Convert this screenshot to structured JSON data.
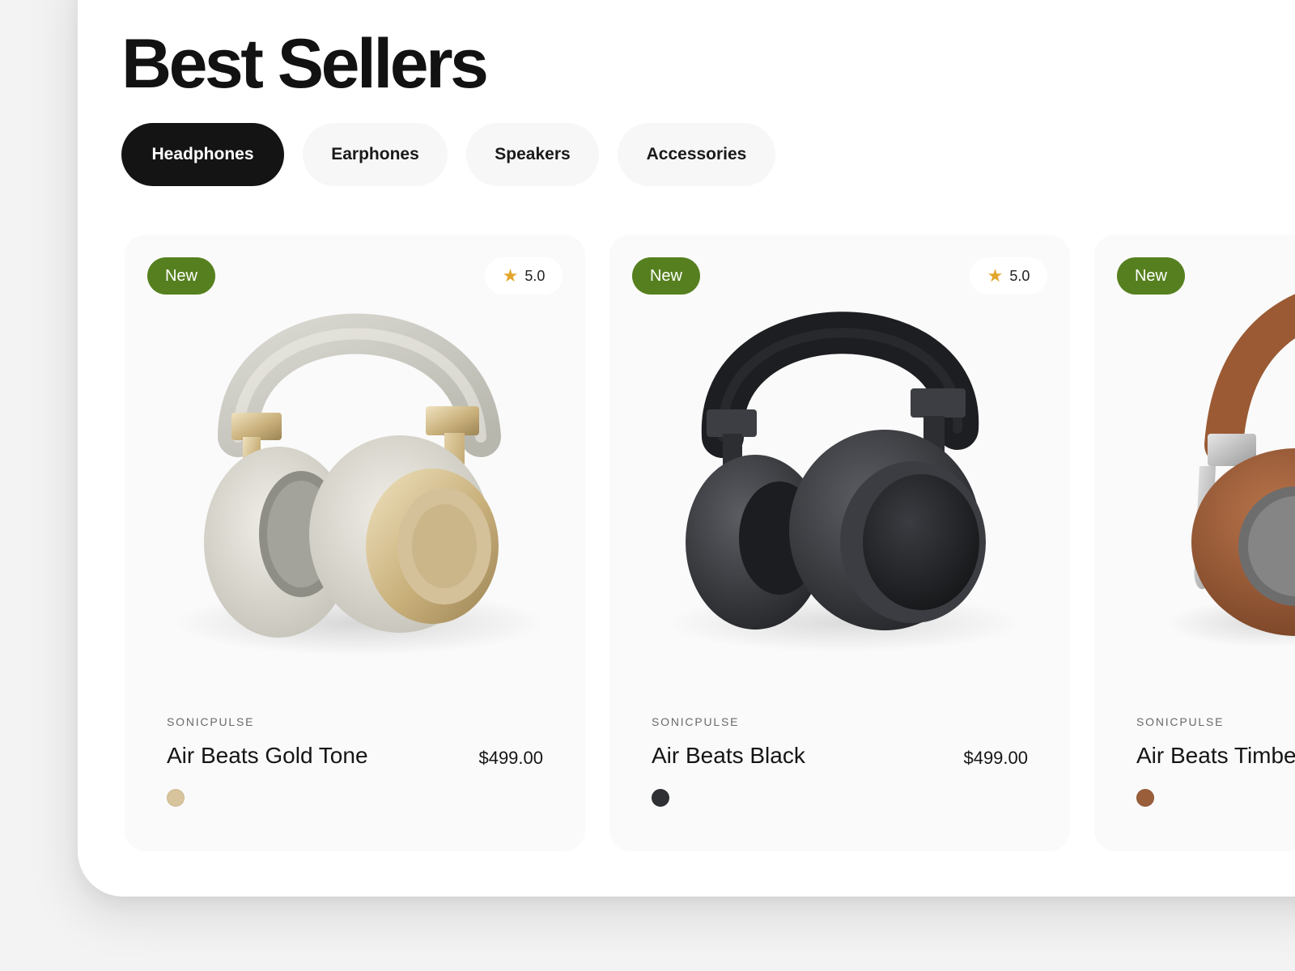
{
  "page": {
    "title": "Best Sellers"
  },
  "tabs": [
    {
      "label": "Headphones",
      "active": true
    },
    {
      "label": "Earphones",
      "active": false
    },
    {
      "label": "Speakers",
      "active": false
    },
    {
      "label": "Accessories",
      "active": false
    }
  ],
  "products": [
    {
      "badge": "New",
      "rating": "5.0",
      "brand": "SONICPULSE",
      "name": "Air Beats Gold Tone",
      "price": "$499.00",
      "swatch_color": "#d8c49c",
      "image_icon": "headphones-gold-icon"
    },
    {
      "badge": "New",
      "rating": "5.0",
      "brand": "SONICPULSE",
      "name": "Air Beats Black",
      "price": "$499.00",
      "swatch_color": "#2e3034",
      "image_icon": "headphones-black-icon"
    },
    {
      "badge": "New",
      "brand": "SONICPULSE",
      "name": "Air Beats Timbe",
      "swatch_color": "#9b5e3b",
      "image_icon": "headphones-brown-icon"
    }
  ],
  "colors": {
    "accent_green": "#56801f",
    "active_tab": "#141414",
    "star": "#e2a62b"
  }
}
